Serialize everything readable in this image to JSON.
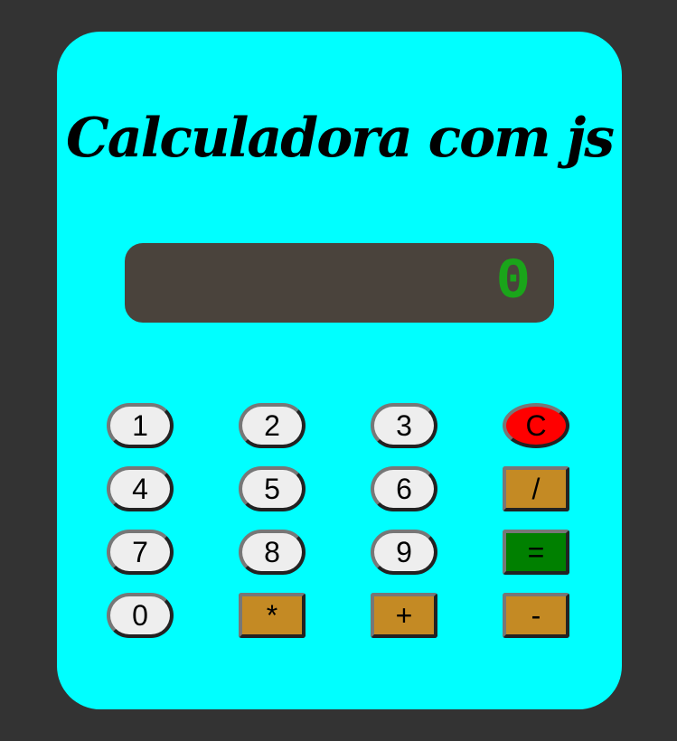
{
  "page": {
    "title": "Calculadora com js",
    "background_color": "#333333",
    "calculator_color": "#00ffff"
  },
  "display": {
    "value": "0",
    "background_color": "#4a433c",
    "text_color": "#1aa51a"
  },
  "keys": {
    "k1": "1",
    "k2": "2",
    "k3": "3",
    "clear": "C",
    "k4": "4",
    "k5": "5",
    "k6": "6",
    "divide": "/",
    "k7": "7",
    "k8": "8",
    "k9": "9",
    "equals": "=",
    "k0": "0",
    "multiply": "*",
    "plus": "+",
    "minus": "-"
  },
  "colors": {
    "number_key": "#eeeeee",
    "operator_key": "#c48a24",
    "equals_key": "#008000",
    "clear_key": "#ff0000"
  }
}
